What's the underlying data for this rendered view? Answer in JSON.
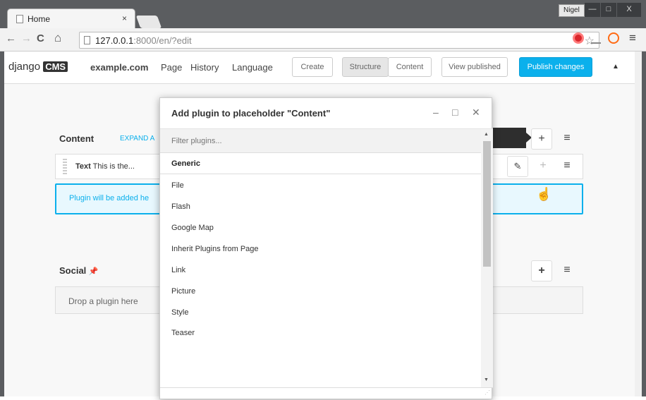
{
  "browser": {
    "tab_title": "Home",
    "tab_close": "×",
    "user_name": "Nigel",
    "minimize": "—",
    "maximize": "□",
    "close": "X",
    "url_host": "127.0.0.1",
    "url_path": ":8000/en/?edit",
    "back": "←",
    "forward": "→",
    "reload": "C",
    "home": "⌂",
    "bookmark_star": "☆",
    "menu": "≡"
  },
  "cms_toolbar": {
    "logo_django": "django",
    "logo_cms": "CMS",
    "site_name": "example.com",
    "menu_items": [
      "Page",
      "History",
      "Language"
    ],
    "create_label": "Create",
    "structure_label": "Structure",
    "content_label": "Content",
    "view_published_label": "View published",
    "publish_label": "Publish changes",
    "caret": "▲"
  },
  "placeholders": {
    "content": {
      "title": "Content",
      "expand_label": "EXPAND A",
      "plugin_name": "Text",
      "plugin_preview": "This is the...",
      "dropzone_text": "Plugin will be added he"
    },
    "social": {
      "title": "Social",
      "pin": "📌",
      "drop_text": "Drop a plugin here"
    }
  },
  "modal": {
    "title": "Add plugin to placeholder \"Content\"",
    "minimize": "–",
    "maximize": "□",
    "close": "✕",
    "filter_placeholder": "Filter plugins...",
    "section": "Generic",
    "plugins": [
      "File",
      "Flash",
      "Google Map",
      "Inherit Plugins from Page",
      "Link",
      "Picture",
      "Style",
      "Teaser"
    ],
    "resize_grip": "⋰"
  },
  "icons": {
    "add": "+",
    "menu": "≡",
    "edit": "✎",
    "cursor": "☝"
  },
  "colors": {
    "accent": "#0bb0ec",
    "window": "#5b5d60"
  }
}
